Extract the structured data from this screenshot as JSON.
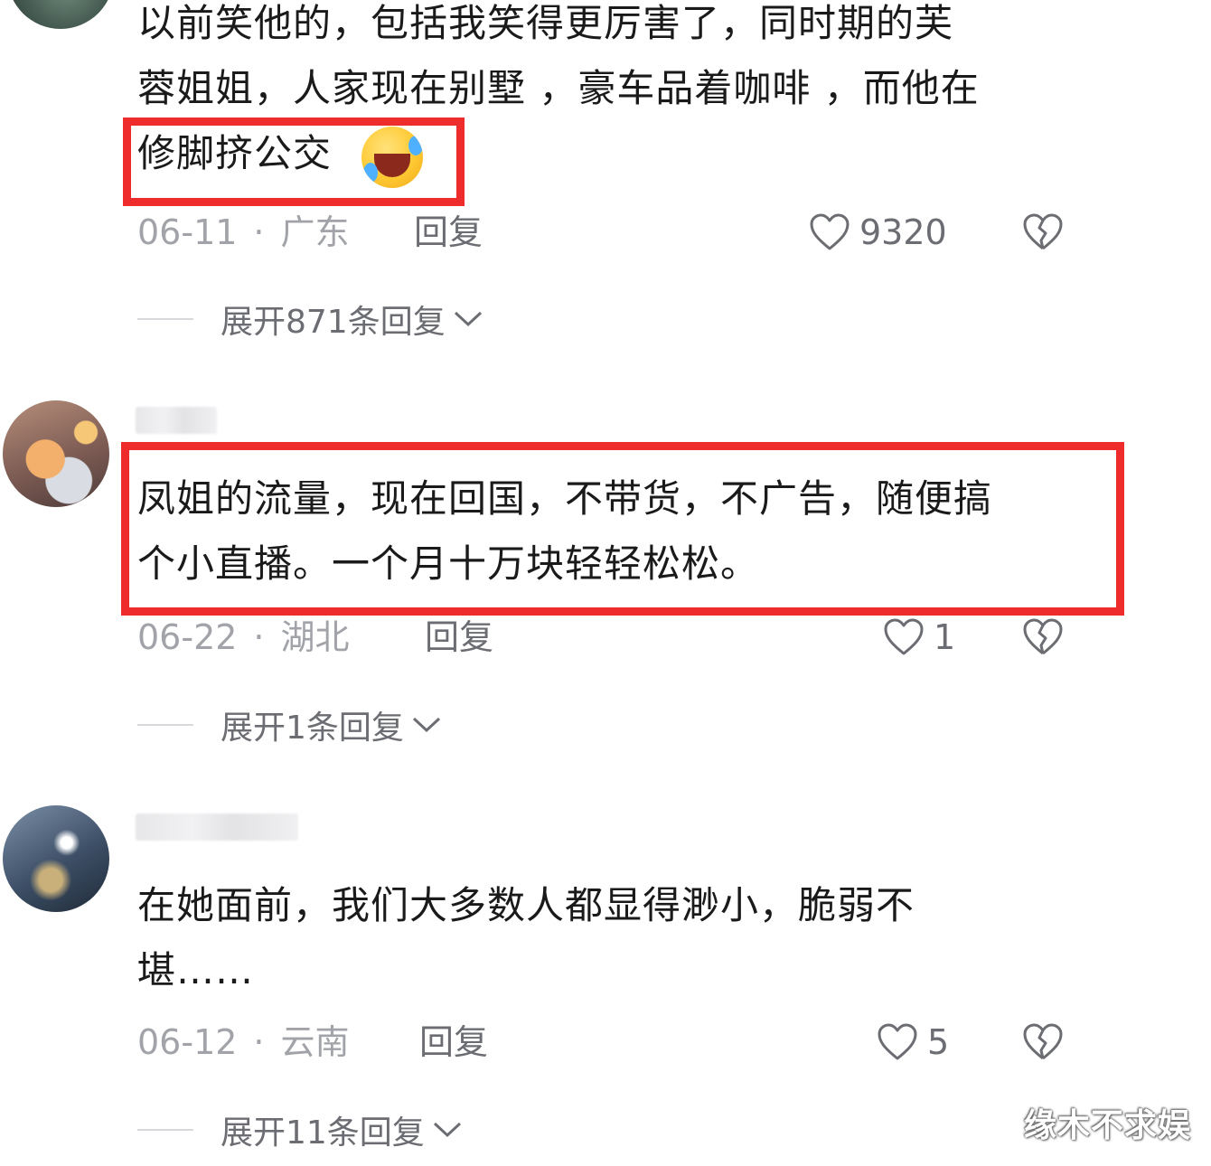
{
  "comments": [
    {
      "text": "以前笑他的，包括我笑得更厉害了，同时期的芙\n蓉姐姐，人家现在别墅 ，豪车品着咖啡 ，而他在\n修脚挤公交",
      "emoji": "rolling-on-floor-laughing",
      "date": "06-11",
      "location": "广东",
      "reply_label": "回复",
      "likes": "9320",
      "expand_label": "展开871条回复"
    },
    {
      "text": "凤姐的流量，现在回国，不带货，不广告，随便搞\n个小直播。一个月十万块轻轻松松。",
      "date": "06-22",
      "location": "湖北",
      "reply_label": "回复",
      "likes": "1",
      "expand_label": "展开1条回复"
    },
    {
      "text": "在她面前，我们大多数人都显得渺小，脆弱不\n堪……",
      "date": "06-12",
      "location": "云南",
      "reply_label": "回复",
      "likes": "5",
      "expand_label": "展开11条回复"
    }
  ],
  "separator": "·",
  "watermark": "缘木不求娱",
  "colors": {
    "highlight": "#ee2c2c",
    "meta": "#a1a3a8",
    "text": "#1a1a1a"
  }
}
